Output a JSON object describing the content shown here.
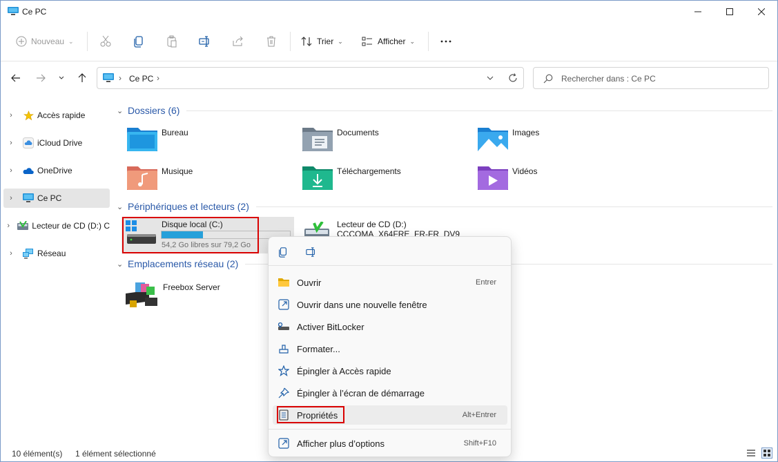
{
  "window": {
    "title": "Ce PC",
    "controls": [
      "minimize-icon",
      "maximize-icon",
      "close-icon"
    ]
  },
  "toolbar": {
    "new_label": "Nouveau",
    "sort_label": "Trier",
    "view_label": "Afficher",
    "icons": [
      "cut-icon",
      "copy-icon",
      "paste-icon",
      "rename-icon",
      "share-icon",
      "delete-icon",
      "more-icon"
    ]
  },
  "address": {
    "crumb": "Ce PC",
    "search_placeholder": "Rechercher dans : Ce PC"
  },
  "sidebar": {
    "items": [
      {
        "label": "Accès rapide",
        "icon": "star-icon"
      },
      {
        "label": "iCloud Drive",
        "icon": "icloud-icon"
      },
      {
        "label": "OneDrive",
        "icon": "cloud-icon"
      },
      {
        "label": "Ce PC",
        "icon": "computer-icon",
        "selected": true
      },
      {
        "label": "Lecteur de CD (D:) C",
        "icon": "cd-drive-icon"
      },
      {
        "label": "Réseau",
        "icon": "network-icon"
      }
    ]
  },
  "groups": {
    "folders_title": "Dossiers (6)",
    "devices_title": "Périphériques et lecteurs (2)",
    "network_title": "Emplacements réseau (2)"
  },
  "folders": [
    {
      "name": "Bureau",
      "icon": "desktop-folder-icon"
    },
    {
      "name": "Documents",
      "icon": "documents-folder-icon"
    },
    {
      "name": "Images",
      "icon": "pictures-folder-icon"
    },
    {
      "name": "Musique",
      "icon": "music-folder-icon"
    },
    {
      "name": "Téléchargements",
      "icon": "downloads-folder-icon"
    },
    {
      "name": "Vidéos",
      "icon": "videos-folder-icon"
    }
  ],
  "drives": {
    "c": {
      "name": "Disque local (C:)",
      "free": "54,2 Go libres sur 79,2 Go",
      "used_fraction": 0.32
    },
    "d": {
      "name": "Lecteur de CD (D:)",
      "label": "CCCOMA_X64FRE_FR-FR_DV9"
    }
  },
  "network_locations": [
    {
      "name": "Freebox Server",
      "icon": "media-server-icon"
    }
  ],
  "context_menu": {
    "top_icons": [
      "copy-icon",
      "rename-icon"
    ],
    "items": [
      {
        "label": "Ouvrir",
        "shortcut": "Entrer",
        "icon": "folder-open-icon"
      },
      {
        "label": "Ouvrir dans une nouvelle fenêtre",
        "shortcut": "",
        "icon": "new-window-icon"
      },
      {
        "label": "Activer BitLocker",
        "shortcut": "",
        "icon": "key-icon"
      },
      {
        "label": "Formater...",
        "shortcut": "",
        "icon": "format-icon"
      },
      {
        "label": "Épingler à Accès rapide",
        "shortcut": "",
        "icon": "star-outline-icon"
      },
      {
        "label": "Épingler à l’écran de démarrage",
        "shortcut": "",
        "icon": "pin-icon"
      },
      {
        "label": "Propriétés",
        "shortcut": "Alt+Entrer",
        "icon": "properties-icon"
      },
      {
        "label": "Afficher plus d’options",
        "shortcut": "Shift+F10",
        "icon": "more-options-icon"
      }
    ]
  },
  "status": {
    "count": "10 élément(s)",
    "selection": "1 élément sélectionné"
  },
  "colors": {
    "accent": "#2a59a8",
    "highlight_border": "#d90000",
    "drive_bar": "#26a0da"
  }
}
